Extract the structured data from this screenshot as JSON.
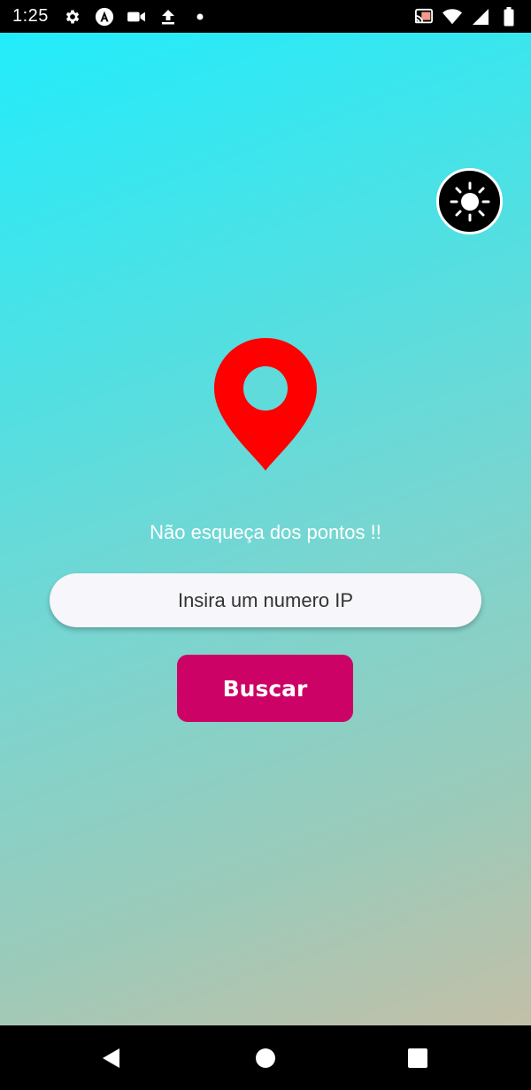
{
  "status_bar": {
    "time": "1:25",
    "left_icons": [
      "gear-icon",
      "a-circle-icon",
      "video-camera-icon",
      "upload-icon",
      "dot-icon"
    ],
    "right_icons": [
      "cast-icon",
      "wifi-icon",
      "signal-icon",
      "battery-icon"
    ]
  },
  "app": {
    "background_colors": [
      "#22ecfb",
      "#c3bfa7"
    ],
    "theme_toggle_icon": "sun-icon",
    "pin_icon": "location-pin-icon",
    "pin_color": "#ff0000",
    "hint_text": "Não esqueça dos pontos !!",
    "ip_input": {
      "placeholder": "Insira um numero IP",
      "value": ""
    },
    "search_button_label": "Buscar",
    "button_color": "#cc0266"
  },
  "nav_bar": {
    "icons": [
      "back-icon",
      "home-icon",
      "recents-icon"
    ]
  }
}
